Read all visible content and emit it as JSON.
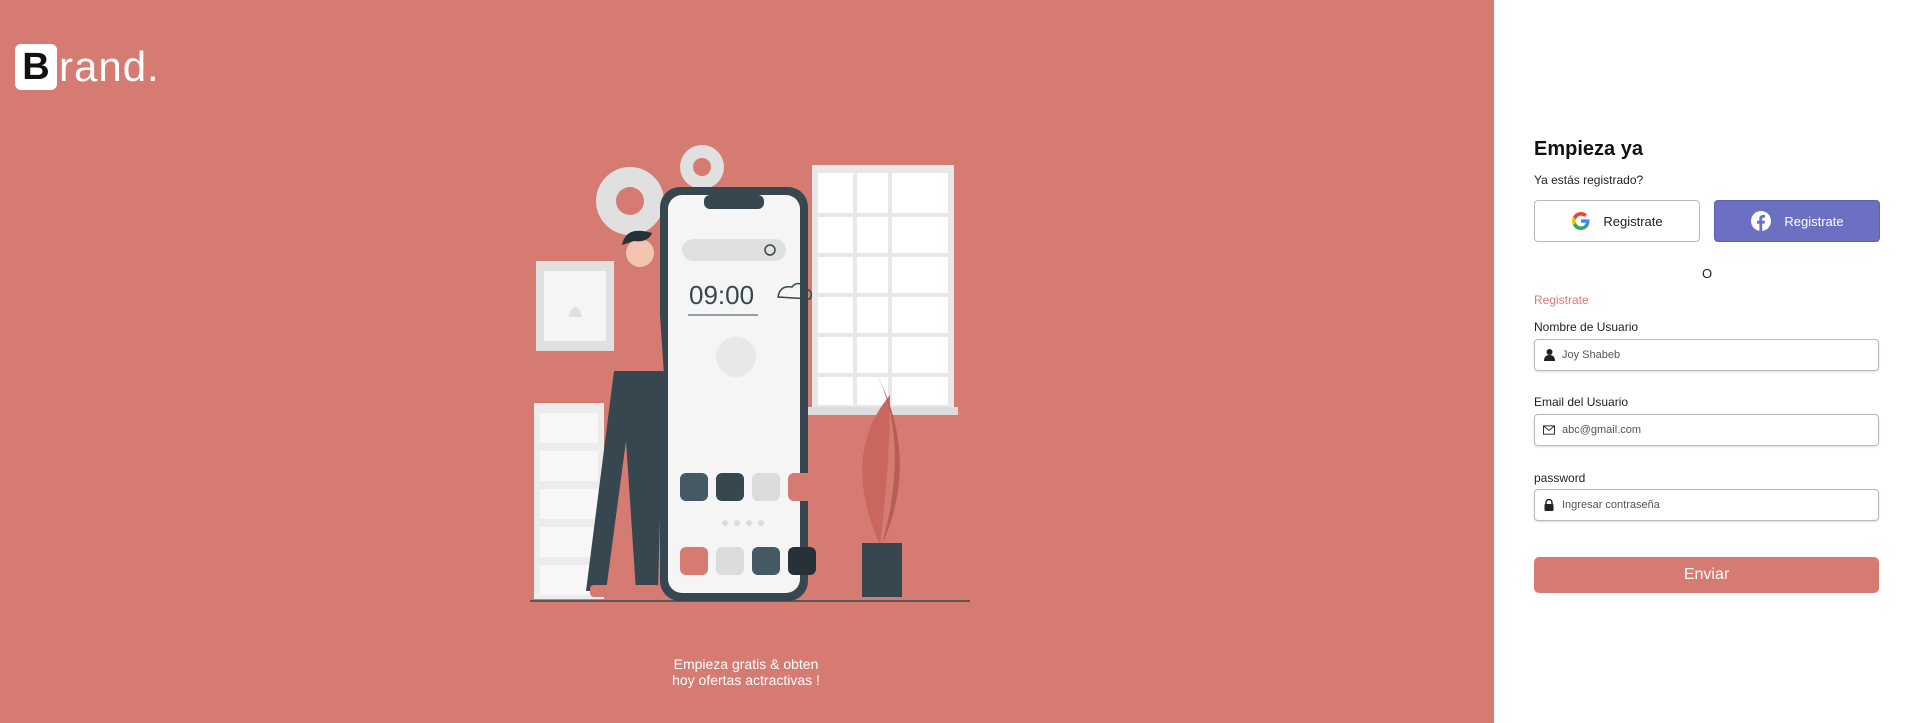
{
  "brand": {
    "initial": "B",
    "rest": "rand."
  },
  "illustration": {
    "clock_time": "09:00",
    "icons": [
      "magnifier-icon",
      "rain-cloud-icon",
      "gear-icon",
      "user-icon",
      "cloud-icon",
      "wifi-icon",
      "phone-icon",
      "search-icon",
      "whatsapp-icon",
      "instagram-icon"
    ]
  },
  "tagline": {
    "line1": "Empieza gratis & obten",
    "line2": "hoy ofertas actractivas !"
  },
  "form": {
    "title": "Empieza ya",
    "subtitle": "Ya estás registrado?",
    "google_button": "Registrate",
    "facebook_button": "Registrate",
    "or_text": "O",
    "register_link": "Registrate",
    "username": {
      "label": "Nombre de Usuario",
      "placeholder": "Joy Shabeb"
    },
    "email": {
      "label": "Email del Usuario",
      "placeholder": "abc@gmail.com"
    },
    "password": {
      "label": "password",
      "placeholder": "Ingresar contraseña"
    },
    "submit_label": "Enviar"
  },
  "colors": {
    "accent": "#d67b72",
    "facebook": "#6b70c2",
    "dark": "#37474f"
  }
}
